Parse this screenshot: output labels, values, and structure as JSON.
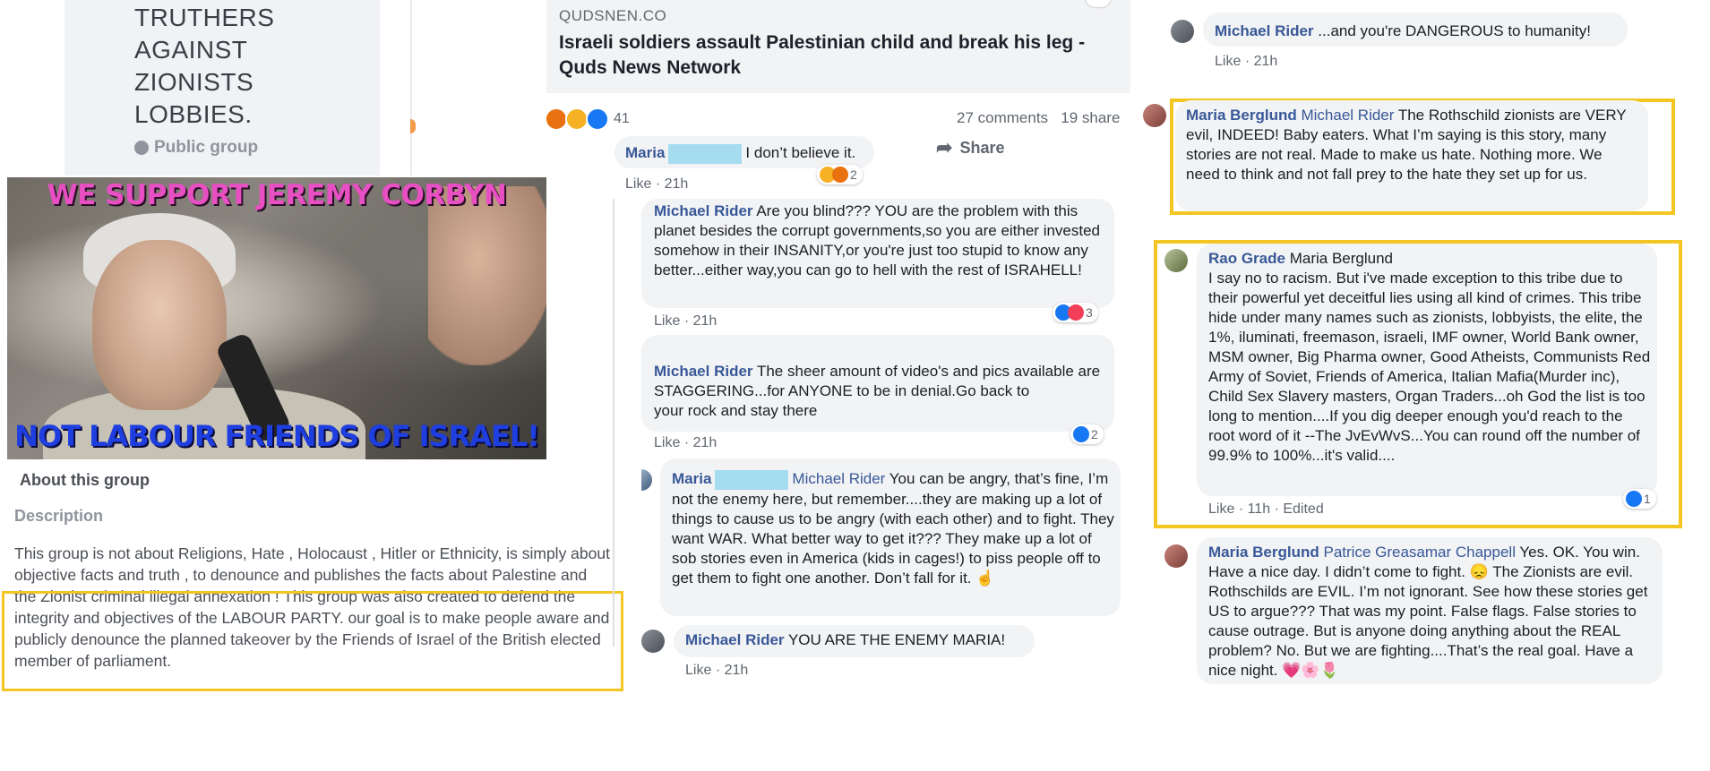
{
  "group": {
    "name": "TRUTHERS\nAGAINST\nZIONISTS\nLOBBIES.",
    "privacy": "Public group",
    "banner_top_text": "WE SUPPORT JEREMY CORBYN",
    "banner_bottom_text": "NOT LABOUR FRIENDS OF ISRAEL!",
    "about_title": "About this group",
    "description_title": "Description",
    "description": "This group is not about Religions, Hate , Holocaust , Hitler or  Ethnicity, is simply about objective facts and truth , to denounce and publishes the facts about Palestine and the Zionist criminal illegal annexation ! This group was also created to defend the integrity and objectives of the LABOUR PARTY. our goal is  to make people aware and  publicly denounce the planned takeover by the Friends of Israel of the British elected member of parliament."
  },
  "article": {
    "domain": "QUDSNEN.CO",
    "title": "Israeli soldiers assault Palestinian child and break his leg - Quds News Network",
    "reaction_count": "41",
    "comments": "27 comments",
    "shares": "19 share",
    "share_label": "Share"
  },
  "middle_comments": [
    {
      "author": "Maria",
      "text": "I don’t believe it.",
      "like": "Like",
      "time": "21h",
      "reaction_count": "2"
    },
    {
      "author": "Michael Rider",
      "text": "Are you blind??? YOU are the problem with this planet besides the corrupt governments,so you are either invested somehow in their INSANITY,or you're just too stupid to know any better...either way,you can go to hell with the rest of ISRAHELL!",
      "like": "Like",
      "time": "21h",
      "reaction_count": "3"
    },
    {
      "author": "Michael Rider",
      "text": "The sheer amount of video's and pics available are STAGGERING...for ANYONE to be in denial.Go back to\nyour rock and stay there",
      "like": "Like",
      "time": "21h",
      "reaction_count": "2"
    },
    {
      "author": "Maria",
      "tag": "Michael Rider",
      "text": "You can be angry, that’s fine, I’m not the enemy here, but remember....they are making up a lot of things to cause us to be angry (with each other) and to fight. They want WAR. What better way to get it??? They make up a lot of sob stories even in America (kids in cages!) to piss people off to get them to fight one another. Don’t fall for it. ☝"
    },
    {
      "author": "Michael Rider",
      "text": "YOU ARE THE ENEMY MARIA!",
      "like": "Like",
      "time": "21h"
    }
  ],
  "right_comments": [
    {
      "author": "Michael Rider",
      "text": "...and you're DANGEROUS to humanity!",
      "like": "Like",
      "time": "21h"
    },
    {
      "author": "Maria Berglund",
      "tag": "Michael Rider",
      "text": "The Rothschild zionists are VERY evil, INDEED! Baby eaters. What I’m saying is this story, many stories are not real. Made to make us hate. Nothing more. We need to think and not fall prey to the hate they set up for us."
    },
    {
      "author": "Rao Grade",
      "tag": "Maria Berglund",
      "text": "I say no to racism. But i've made exception to this tribe due to their powerful yet deceitful lies using all kind of crimes. This tribe hide under many names such as zionists, lobbyists, the elite, the 1%, iluminati, freemason, israeli, IMF owner, World Bank owner, MSM owner, Big Pharma owner, Good Atheists, Communists Red Army of Soviet, Friends of America, Italian Mafia(Murder inc), Child Sex Slavery masters, Organ Traders...oh God the list is too long to mention....If you dig deeper enough you'd reach to the root word of it --The JvEvWvS...You can round off the number of 99.9% to 100%...it's valid....",
      "like": "Like",
      "time": "11h",
      "edited": "Edited",
      "reaction_count": "1"
    },
    {
      "author": "Maria Berglund",
      "tag": "Patrice Greasamar Chappell",
      "text": "Yes. OK. You win. Have a nice day. I didn’t come to fight. 😞 The Zionists are evil. Rothschilds are EVIL. I’m not ignorant. See how these stories get US to argue??? That was my point. False flags. False stories to cause outrage. But is anyone doing anything about the REAL problem? No. But we are fighting....That’s the real goal. Have a nice night. 💗🌸🌷"
    }
  ],
  "separator": "·",
  "colors": {
    "highlight": "#f3c623",
    "link_name": "#385898",
    "bubble": "#f2f3f5",
    "redaction": "#a6dcef"
  }
}
